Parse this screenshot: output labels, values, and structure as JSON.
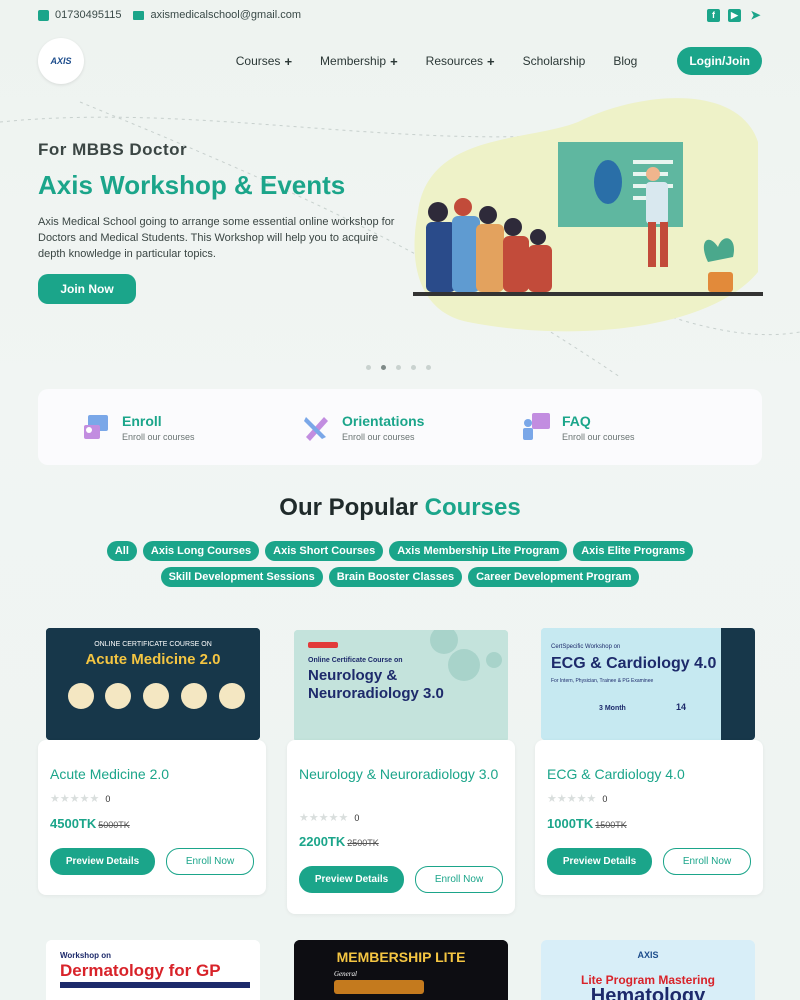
{
  "topbar": {
    "phone": "01730495115",
    "email": "axismedicalschool@gmail.com"
  },
  "nav": {
    "logo_text": "AXIS",
    "items": [
      {
        "label": "Courses",
        "plus": "+"
      },
      {
        "label": "Membership",
        "plus": "+"
      },
      {
        "label": "Resources",
        "plus": "+"
      },
      {
        "label": "Scholarship",
        "plus": ""
      },
      {
        "label": "Blog",
        "plus": ""
      }
    ],
    "login_label": "Login/Join"
  },
  "hero": {
    "subtitle": "For MBBS Doctor",
    "title": "Axis Workshop & Events",
    "description": "Axis Medical School going to arrange some essential online workshop for Doctors and Medical Students. This Workshop will help you to acquire depth knowledge in particular topics.",
    "cta": "Join Now"
  },
  "features": [
    {
      "title": "Enroll",
      "sub": "Enroll our courses",
      "icon": "enroll-icon"
    },
    {
      "title": "Orientations",
      "sub": "Enroll our courses",
      "icon": "orientation-icon"
    },
    {
      "title": "FAQ",
      "sub": "Enroll our courses",
      "icon": "faq-icon"
    }
  ],
  "popular": {
    "title_main": "Our Popular ",
    "title_accent": "Courses"
  },
  "filters_row1": [
    "All",
    "Axis Long Courses",
    "Axis Short Courses",
    "Axis Membership Lite Program",
    "Axis Elite Programs"
  ],
  "filters_row2": [
    "Skill Development Sessions",
    "Brain Booster Classes",
    "Career Development Program"
  ],
  "courses": [
    {
      "title": "Acute Medicine 2.0",
      "rating_count": "0",
      "price": "4500TK",
      "old_price": "5000TK",
      "preview": "Preview Details",
      "enroll": "Enroll Now",
      "banner_tag": "ONLINE CERTIFICATE COURSE ON",
      "banner_title": "Acute Medicine 2.0"
    },
    {
      "title": "Neurology & Neuroradiology 3.0",
      "rating_count": "0",
      "price": "2200TK",
      "old_price": "2500TK",
      "preview": "Preview Details",
      "enroll": "Enroll Now",
      "banner_tag": "Online Certificate Course on",
      "banner_title": "Neurology & Neuroradiology 3.0"
    },
    {
      "title": "ECG & Cardiology 4.0",
      "rating_count": "0",
      "price": "1000TK",
      "old_price": "1500TK",
      "preview": "Preview Details",
      "enroll": "Enroll Now",
      "banner_tag": "CertSpecific Workshop on",
      "banner_title": "ECG & Cardiology 4.0",
      "banner_sub": "For Intern, Physician, Trainee & PG Examinee",
      "banner_month": "3 Month",
      "banner_hours": "14"
    }
  ],
  "bottom_cards": [
    {
      "tag": "Workshop on",
      "title": "Dermatology for GP"
    },
    {
      "tag": "General",
      "title": "MEMBERSHIP LITE"
    },
    {
      "tag": "Lite Program Mastering",
      "title": "Hematology"
    }
  ],
  "colors": {
    "accent": "#1ba58a"
  }
}
